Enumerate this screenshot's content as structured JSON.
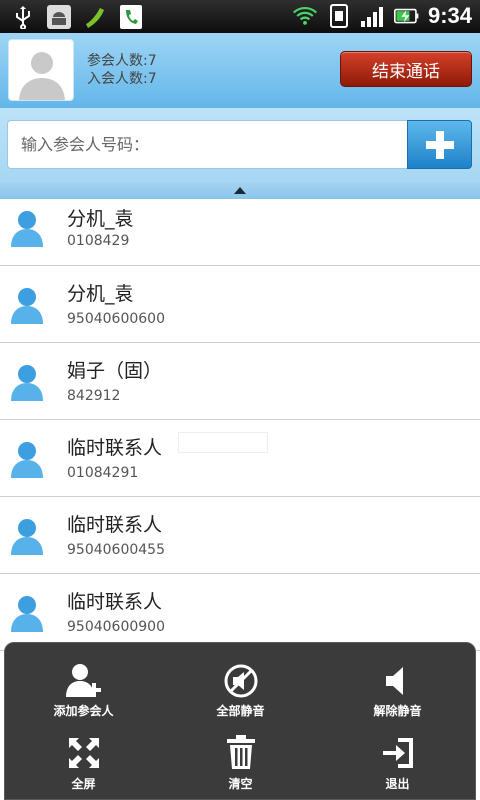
{
  "status_bar": {
    "time": "9:34"
  },
  "header": {
    "participant_count": "参会人数:7",
    "joined_count": "入会人数:7",
    "end_button": "结束通话"
  },
  "input": {
    "placeholder": "输入参会人号码："
  },
  "participants": [
    {
      "name": "分机_袁",
      "number": "0108429"
    },
    {
      "name": "分机_袁",
      "number": "95040600600"
    },
    {
      "name": "娟子（固）",
      "number": "842912"
    },
    {
      "name": "临时联系人",
      "number": "01084291"
    },
    {
      "name": "临时联系人",
      "number": "95040600455"
    },
    {
      "name": "临时联系人",
      "number": "95040600900"
    }
  ],
  "menu": {
    "add": "添加参会人",
    "mute_all": "全部静音",
    "unmute": "解除静音",
    "fullscreen": "全屏",
    "clear": "清空",
    "exit": "退出"
  },
  "colors": {
    "header_blue": "#63b6ea",
    "end_red": "#c0321c",
    "add_blue": "#1d82c8",
    "menu_bg": "#3b3b3b"
  }
}
